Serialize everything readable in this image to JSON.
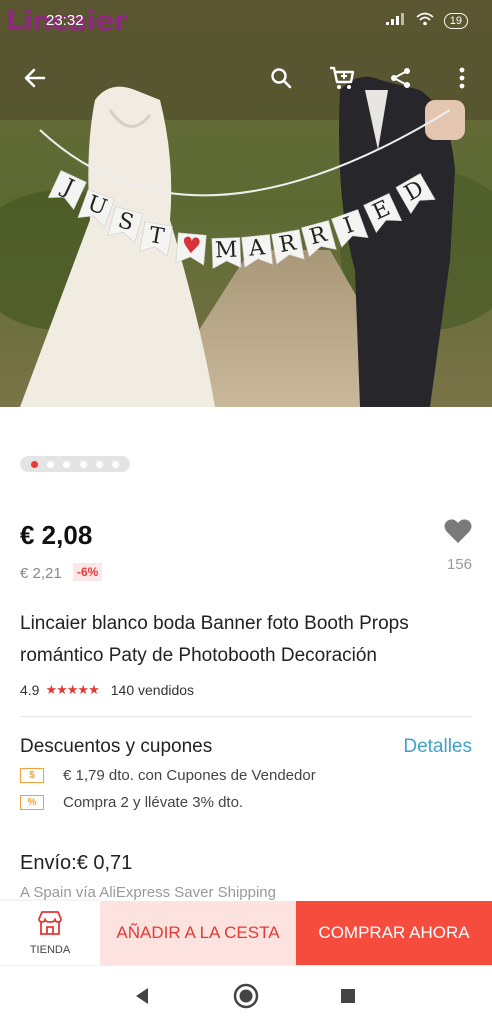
{
  "status_bar": {
    "watermark": "Lincaier",
    "time": "23:32",
    "battery": "19"
  },
  "toolbar": {
    "icons": [
      "back-arrow-icon",
      "search-icon",
      "cart-icon",
      "share-icon",
      "more-vert-icon"
    ]
  },
  "hero": {
    "banner_left": [
      "J",
      "U",
      "S",
      "T",
      "♥"
    ],
    "banner_right": [
      "M",
      "A",
      "R",
      "R",
      "I",
      "E",
      "D"
    ]
  },
  "gallery": {
    "count": 6,
    "active": 0
  },
  "product": {
    "price": "€ 2,08",
    "old_price": "€ 2,21",
    "discount": "-6%",
    "likes": "156",
    "title": "Lincaier blanco boda Banner foto Booth Props romántico Paty de Photobooth Decoración",
    "rating": "4.9",
    "stars": "★★★★★",
    "sold": "140 vendidos"
  },
  "coupons": {
    "title": "Descuentos y cupones",
    "details_label": "Detalles",
    "items": [
      {
        "tag": "$",
        "text": "€ 1,79 dto. con Cupones de Vendedor"
      },
      {
        "tag": "%",
        "text": "Compra 2 y llévate 3% dto."
      }
    ]
  },
  "shipping": {
    "cost": "Envío:€ 0,71",
    "detail": "A Spain vía AliExpress Saver Shipping"
  },
  "actions": {
    "store": "TIENDA",
    "add_to_cart": "AÑADIR A LA CESTA",
    "buy_now": "COMPRAR AHORA"
  },
  "colors": {
    "accent": "#f54c3e",
    "accent_light": "#fde3e0",
    "link": "#3fa3c7",
    "star": "#e53935"
  }
}
